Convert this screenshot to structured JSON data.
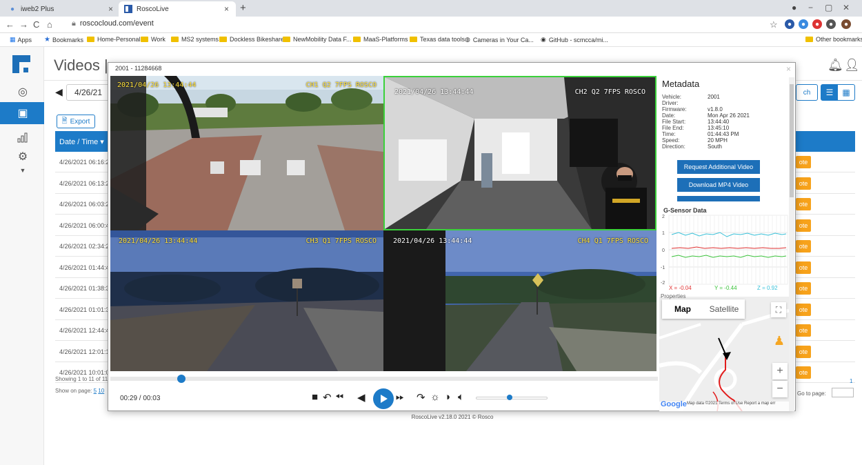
{
  "browser": {
    "tabs": [
      {
        "label": "iweb2 Plus"
      },
      {
        "label": "RoscoLive"
      }
    ],
    "url": "roscocloud.com/event",
    "bookmarks": [
      "Apps",
      "Bookmarks",
      "Home-Personal",
      "Work",
      "MS2 systems",
      "Dockless Bikeshare",
      "NewMobility Data F...",
      "MaaS-Platforms",
      "Texas data tools",
      "Cameras in Your Ca...",
      "GitHub - scmcca/mi..."
    ],
    "other_bookmarks": "Other bookmarks"
  },
  "app": {
    "title": "Videos |",
    "date": "4/26/21",
    "export_label": "Export",
    "search_label": "ch",
    "table": {
      "header": "Date / Time",
      "rows": [
        "4/26/2021 06:16:2",
        "4/26/2021 06:13:2",
        "4/26/2021 06:03:2",
        "4/26/2021 06:00:4",
        "4/26/2021 02:34:2",
        "4/26/2021 01:44:4",
        "4/26/2021 01:38:3",
        "4/26/2021 01:01:3",
        "4/26/2021 12:44:4",
        "4/26/2021 12:01:1",
        "4/26/2021 10:01:0"
      ],
      "note_label": "ote"
    },
    "showing": "Showing 1 to 11 of 11",
    "show_on_page": "Show on page:",
    "page_sizes": [
      "5",
      "10"
    ],
    "go_to_page": "Go to page:",
    "page_one": "1",
    "footer": "RoscoLive v2.18.0 2021 © Rosco"
  },
  "modal": {
    "title": "2001 - 11284668",
    "cameras": [
      {
        "ts": "2021/04/26 13:44:44",
        "tag": "CH1 Q2 7FPS ROSCO"
      },
      {
        "ts": "2021/04/26 13:44:44",
        "tag": "CH2 Q2 7FPS ROSCO"
      },
      {
        "ts": "2021/04/26 13:44:44",
        "tag": "CH3 Q1 7FPS ROSCO"
      },
      {
        "ts": "2021/04/26 13:44:44",
        "tag": "CH4 Q1 7FPS ROSCO"
      }
    ],
    "player": {
      "timecode": "00:29 / 00:03",
      "progress": 0.13,
      "volume": 0.47
    },
    "metadata": {
      "title": "Metadata",
      "fields": [
        {
          "k": "Vehicle:",
          "v": "2001"
        },
        {
          "k": "Driver:",
          "v": ""
        },
        {
          "k": "Firmware:",
          "v": "v1.8.0"
        },
        {
          "k": "Date:",
          "v": "Mon Apr 26 2021"
        },
        {
          "k": "File Start:",
          "v": "13:44:40"
        },
        {
          "k": "File End:",
          "v": "13:45:10"
        },
        {
          "k": "Time:",
          "v": "01:44:43 PM"
        },
        {
          "k": "Speed:",
          "v": "20 MPH"
        },
        {
          "k": "Direction:",
          "v": "South"
        }
      ],
      "buttons": [
        "Request Additional Video",
        "Download MP4 Video"
      ]
    },
    "gsensor": {
      "title": "G-Sensor Data",
      "x_label": "X = -0.04",
      "y_label": "Y = -0.44",
      "z_label": "Z = 0.92",
      "yticks": [
        "2",
        "1",
        "0",
        "-1",
        "-2"
      ]
    },
    "properties_label": "Properties",
    "map": {
      "tabs": [
        "Map",
        "Satellite"
      ],
      "footer": "Map data ©2021   Terms of Use   Report a map err",
      "google": "Google"
    }
  },
  "colors": {
    "accent": "#1d7bc8",
    "note": "#f7a21b",
    "osd": "#ffe03a",
    "active_tile_border": "#3ad13a",
    "gs_x": "#e03030",
    "gs_y": "#3ac23a",
    "gs_z": "#36c0d8"
  }
}
